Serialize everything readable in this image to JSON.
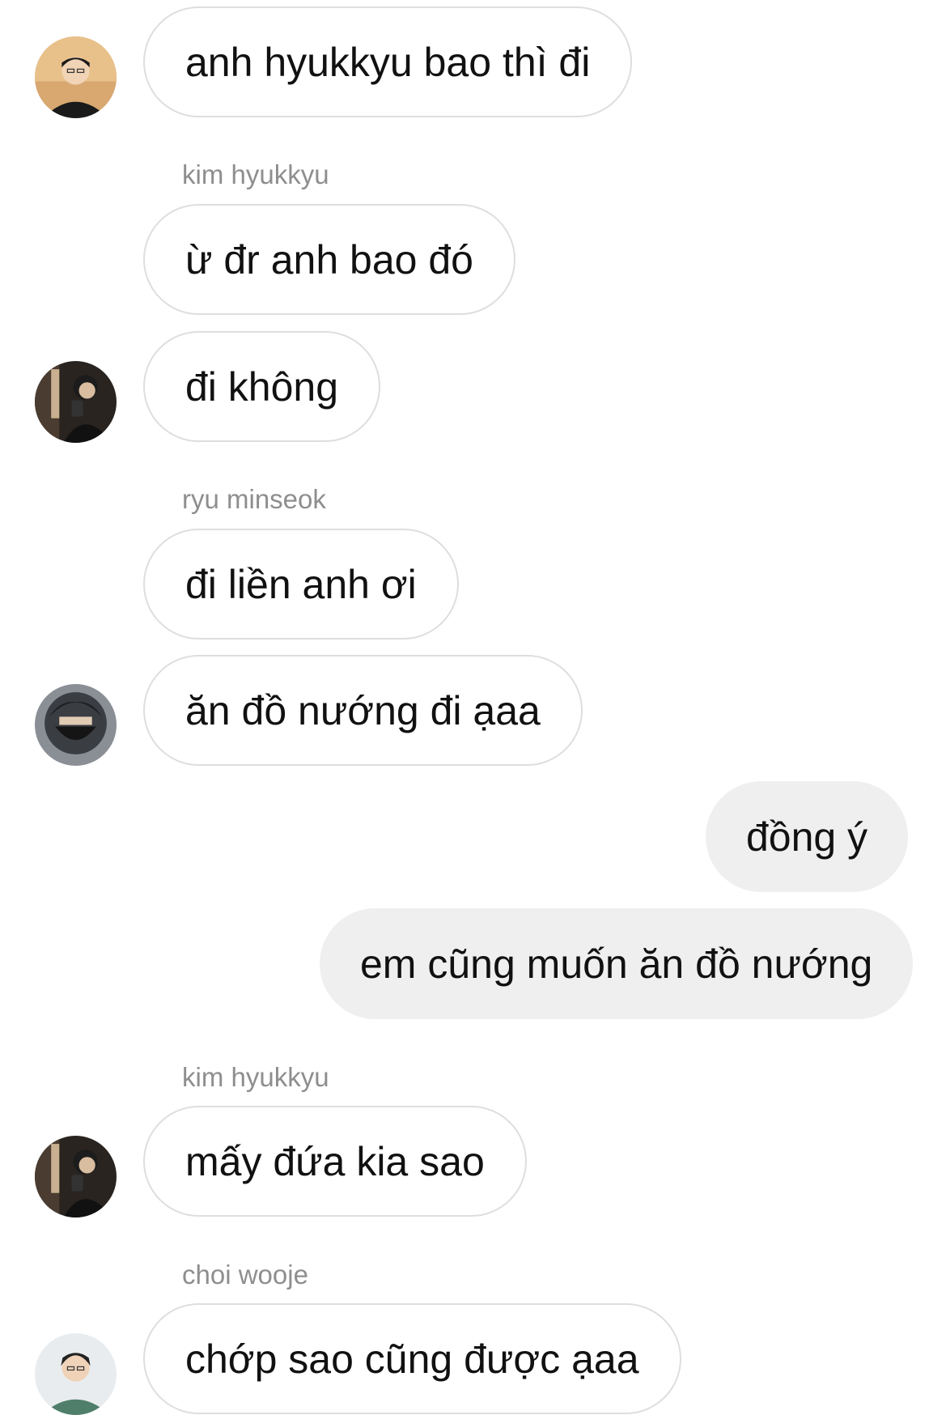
{
  "messages": [
    {
      "type": "in",
      "text": "anh hyukkyu bao thì đi",
      "avatar": "avatar-light-portrait"
    },
    {
      "type": "sender",
      "text": "kim hyukkyu"
    },
    {
      "type": "in",
      "text": "ừ đr anh bao đó"
    },
    {
      "type": "in",
      "text": "đi không",
      "avatar": "avatar-dark-mirror"
    },
    {
      "type": "sender",
      "text": "ryu minseok"
    },
    {
      "type": "in",
      "text": "đi liền anh ơi"
    },
    {
      "type": "in",
      "text": "ăn đồ nướng đi ạaa",
      "avatar": "avatar-masked"
    },
    {
      "type": "out",
      "text": "đồng ý"
    },
    {
      "type": "out",
      "text": "em cũng muốn ăn đồ nướng"
    },
    {
      "type": "sender",
      "text": "kim hyukkyu"
    },
    {
      "type": "in",
      "text": "mấy đứa kia sao",
      "avatar": "avatar-dark-mirror"
    },
    {
      "type": "sender",
      "text": "choi wooje"
    },
    {
      "type": "in",
      "text": "chớp sao cũng được ạaa",
      "avatar": "avatar-green-shirt"
    }
  ],
  "colors": {
    "incoming_border": "#dedede",
    "outgoing_bg": "#efefef",
    "sender_name": "#8e8e8e",
    "text": "#111111"
  }
}
